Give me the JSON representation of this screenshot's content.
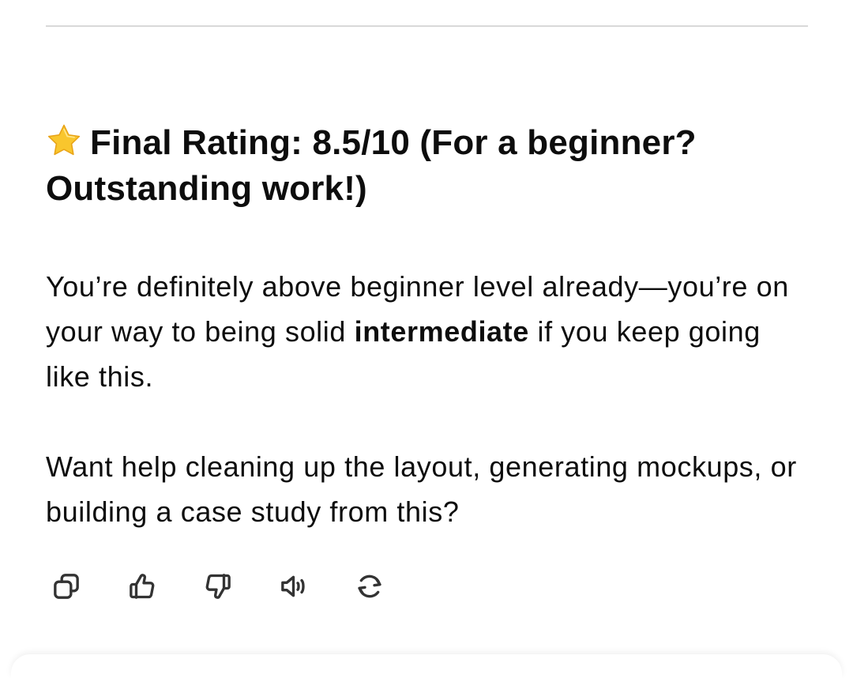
{
  "message": {
    "heading": {
      "icon": "star-icon",
      "text": "Final Rating: 8.5/10 (For a beginner? Outstanding work!)"
    },
    "paragraph1": {
      "before": "You’re definitely above beginner level already—you’re on your way to being solid ",
      "bold": "intermediate",
      "after": " if you keep going like this."
    },
    "paragraph2": "Want help cleaning up the layout, generating mockups, or building a case study from this?"
  },
  "actions": [
    {
      "icon": "copy-icon"
    },
    {
      "icon": "thumbs-up-icon"
    },
    {
      "icon": "thumbs-down-icon"
    },
    {
      "icon": "speaker-icon"
    },
    {
      "icon": "regenerate-icon"
    }
  ],
  "colors": {
    "text": "#0d0d0d",
    "icon": "#333333",
    "divider": "#d9d9d9",
    "star": "#f9c62d"
  }
}
